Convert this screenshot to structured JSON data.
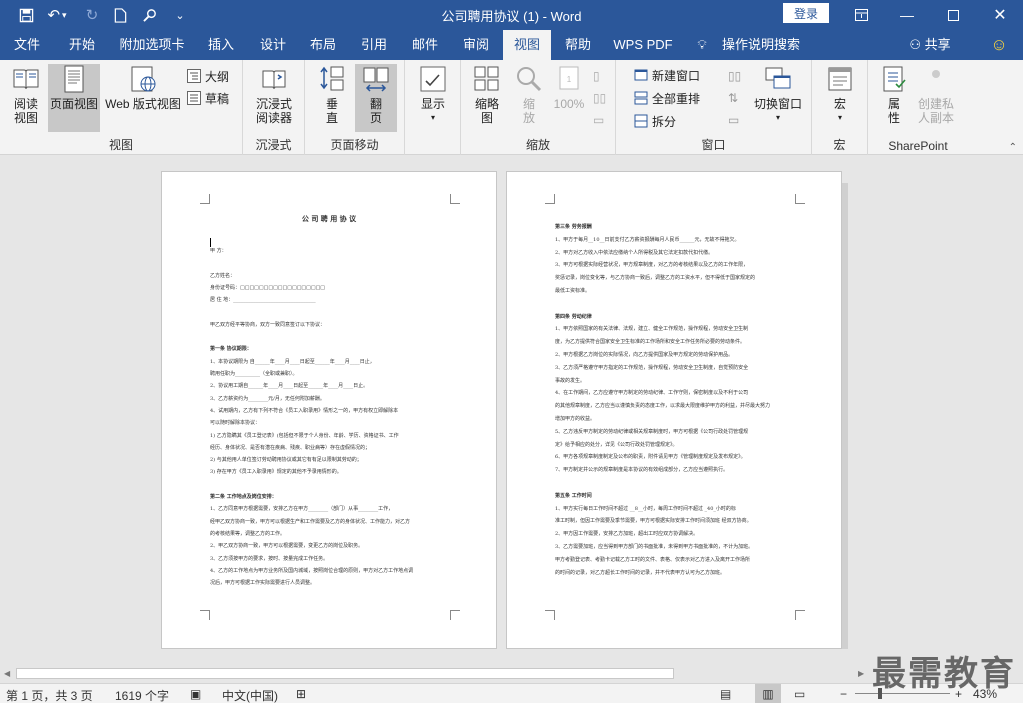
{
  "window": {
    "title": "公司聘用协议 (1)  -  Word",
    "login_label": "登录"
  },
  "tabs": [
    "文件",
    "开始",
    "附加选项卡",
    "插入",
    "设计",
    "布局",
    "引用",
    "邮件",
    "审阅",
    "视图",
    "帮助",
    "WPS PDF",
    "操作说明搜索"
  ],
  "share_label": "共享",
  "ribbon": {
    "views": {
      "read": "阅读视图",
      "print": "页面视图",
      "web": "Web 版式视图",
      "outline": "大纲",
      "draft": "草稿",
      "group": "视图"
    },
    "immersive": {
      "reader": "沉浸式阅读器",
      "group": "沉浸式"
    },
    "pagemove": {
      "vertical": "垂直",
      "flip": "翻页",
      "group": "页面移动"
    },
    "show": {
      "label": "显示"
    },
    "zoom": {
      "zoom": "缩放",
      "percent100": "100%",
      "onepage": "缩略图",
      "group": "缩放"
    },
    "window": {
      "newwin": "新建窗口",
      "arrange": "全部重排",
      "split": "拆分",
      "switch": "切换窗口",
      "group": "窗口"
    },
    "macro": {
      "label": "宏",
      "group": "宏"
    },
    "sharepoint": {
      "props": "属性",
      "private": "创建私人副本",
      "group": "SharePoint"
    }
  },
  "page1": {
    "title": "公 司 聘 用 协 议",
    "lines": [
      "甲        方：",
      "",
      "乙方姓名：",
      "身份证号码：□□□□□□□□□□□□□□□□□□",
      "居    住    地：_________________________________",
      "",
      "甲乙双方经平等协商，双方一致同意签订以下协议：",
      "",
      "第一条  协议期限：",
      "    1、本协议期限为     自______年____月____日起至______年____月____日止，",
      "聘用任职为__________（全职或兼职）。",
      "    2、协议用工期自______年____月____日起至______年____月____日止。",
      "    3、乙方薪资约为________元/月，无任何附加薪酬。",
      "    4、试用期内，乙方有下列不符合《员工入职录用》情形之一的，甲方有权立即解除本",
      "可以随时解除本协议：",
      "    1)   乙方隐瞒其《员工登记表》(包括但不限于个人身份、年龄、学历、资格证书、工作",
      "         经历、身体状况、是否有潜在疾病、残疾、职业病等）存在虚假情况的；",
      "    2)   与其他用人单位签订劳动聘用协议或其它有有足以限制其劳动的；",
      "    3)   存在甲方《员工入职录用》规定的其他不予录用情形的。",
      "",
      "第二条  工作地点及岗位安排：",
      "    1、乙方同意甲方根据需要，安排乙方在甲方________（部门）从事________工作，",
      "经甲乙双方协商一致，甲方可以根据生产和工作需要及乙方的身体状况、工作能力，对乙方",
      "的考核结果等，调整乙方的工作。",
      "    2、甲乙双方协商一致，甲方可以根据需要，变更乙方的岗位及职务。",
      "    3、乙方须按甲方的要求，按时、按量完成工作任务。",
      "    4、乙方的工作地点为甲方业务所及国内城域，按照岗位合理的原则，甲方对乙方工作地点调",
      "况后，甲方可根据工作实际需要进行人员调整。"
    ]
  },
  "page2": {
    "lines": [
      "第三条  劳务报酬",
      "    1、甲方于每月__10__日前支付乙方薪资报酬每月人民币______元，无故不得拖欠。",
      "    2、甲方对乙方收入中依法应缴纳个人所得税及其它法定扣款代扣代缴。",
      "    3、甲方可根据实际经营状况，甲方规章制度，对乙方的考核结果以及乙方的工作年限，",
      "奖惩记录，岗位变化等，与乙方协商一致后，调整乙方的工资水平，但不得低于国家规定的",
      "最低工资标准。",
      "",
      "第四条  劳动纪律",
      "    1、甲方依照国家的有关法律、法规，建立、健全工作规范，操作规程，劳动安全卫生制",
      "度，为乙方提供符合国家安全卫生标准的工作场所和安全工作任务所必要的劳动条件。",
      "    2、甲方根据乙方岗位的实际情况，向乙方提供国家及甲方规定的劳动保护用品。",
      "    3、乙方须严格遵守甲方指定的工作规范，操作规程，劳动安全卫生制度，自觉预防安全",
      "事故的发生。",
      "    4、在工作期间，乙方应遵守甲方制定的劳动纪律、工作守则，保密制度以及不利于公司",
      "的其他规章制度，乙方应当以谨慎负责的态度工作，以求最大限度维护甲方的利益，并尽最大努力",
      "增加甲方的收益。",
      "    5、乙方违反甲方制定的劳动纪律或相关规章制度时，甲方可根据《公司行政处罚管理规",
      "定》给予相应的处分，详见《公司行政处罚管理规定》。",
      "    6、甲方各项规章制度制定及公布的职责，附件请见甲方《管理制度规定及发布规定》。",
      "    7、甲方制定并公示的规章制度是本协议的有效组成部分，乙方应当遵照执行。",
      "",
      "第五条  工作时间",
      "    1、甲方实行每日工作时间不超过 __8__小时，每周工作时间不超过 _40_小时的标",
      "准工时制，但因工作需要及季节需要，甲方可根据实际安排工作时间须加班 经双方协商。",
      "    2、甲方因工作需要，安排乙方加班，超出工时应双方协调解决。",
      "    3、乙方需要加班，应当得到甲方部门的书面批准，未得到甲方书面批准的，不计为加班。",
      "甲方考勤登记表、考勤卡记载乙方工时的文件、表格、仅表示对乙方进入及离开工作场所",
      "的时间的记录，对乙方超长工作时间的记录，并不代表甲方认可为乙方加班。"
    ]
  },
  "status": {
    "page": "第 1 页，共 3 页",
    "words": "1619 个字",
    "lang": "中文(中国)",
    "zoom": "43%"
  },
  "watermark": "最需教育"
}
